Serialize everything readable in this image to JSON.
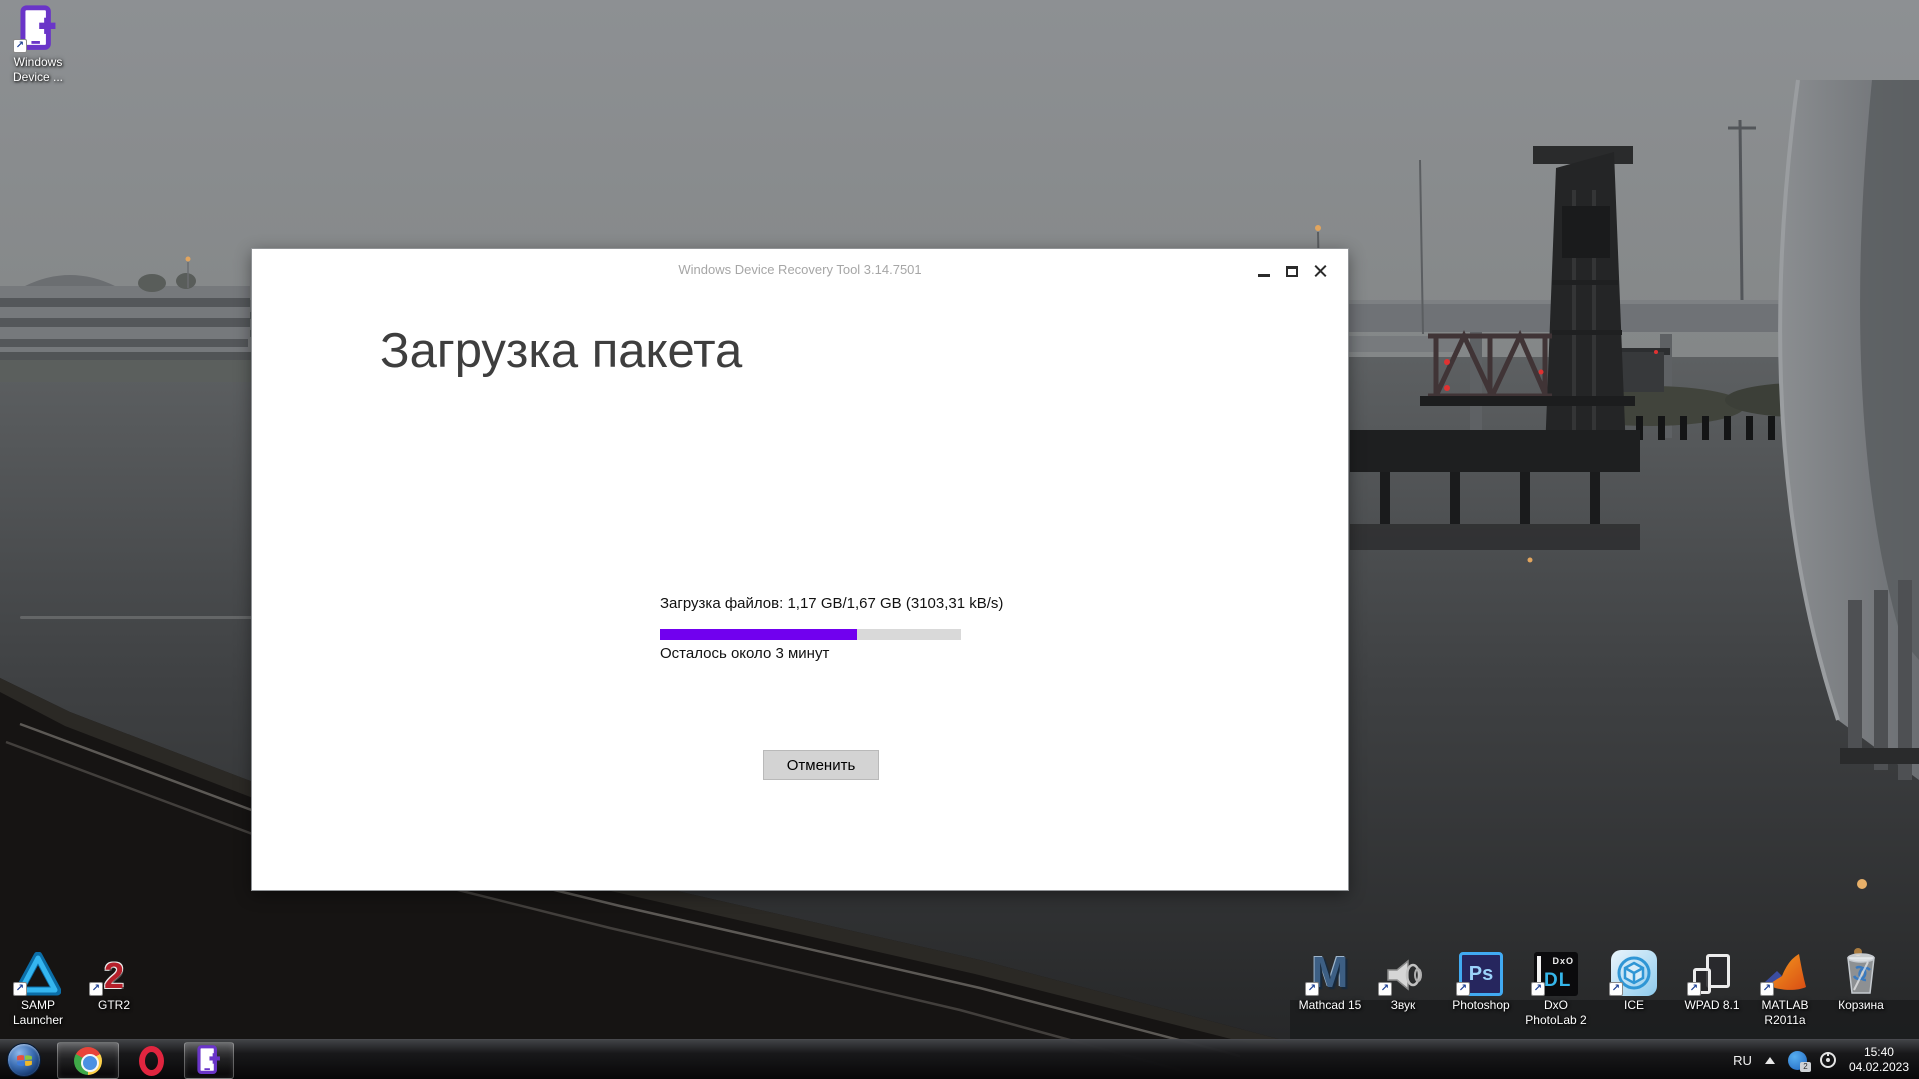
{
  "wallpaper": {
    "sky_color": "#8b8e91",
    "water_color": "#45474a",
    "scene": "rainy harbor with railroad lift bridge and highway overpass"
  },
  "desktop": {
    "icons": [
      {
        "label": "Windows\nDevice ..."
      },
      {
        "label": "SAMP\nLauncher"
      },
      {
        "label": "GTR2",
        "glyph_text": "2"
      },
      {
        "label": "Mathcad 15",
        "glyph_text": "M"
      },
      {
        "label": "Звук"
      },
      {
        "label": "Photoshop",
        "glyph_text": "Ps"
      },
      {
        "label": "DxO\nPhotoLab 2",
        "glyph_brand": "DxO",
        "glyph_text": "DL"
      },
      {
        "label": "ICE"
      },
      {
        "label": "WPAD 8.1"
      },
      {
        "label": "MATLAB\nR2011a"
      },
      {
        "label": "Корзина"
      }
    ]
  },
  "dialog": {
    "title": "Windows Device Recovery Tool 3.14.7501",
    "heading": "Загрузка пакета",
    "progress": {
      "files_label": "Загрузка файлов: 1,17 GB/1,67 GB (3103,31 kB/s)",
      "percent": 65.5,
      "fill_color": "#7100EF",
      "track_color": "#D9D9D9",
      "remaining_label": "Осталось около 3 минут"
    },
    "cancel_button": "Отменить"
  },
  "taskbar": {
    "tray": {
      "language": "RU",
      "badge": "2",
      "clock_time": "15:40",
      "clock_date": "04.02.2023"
    }
  }
}
